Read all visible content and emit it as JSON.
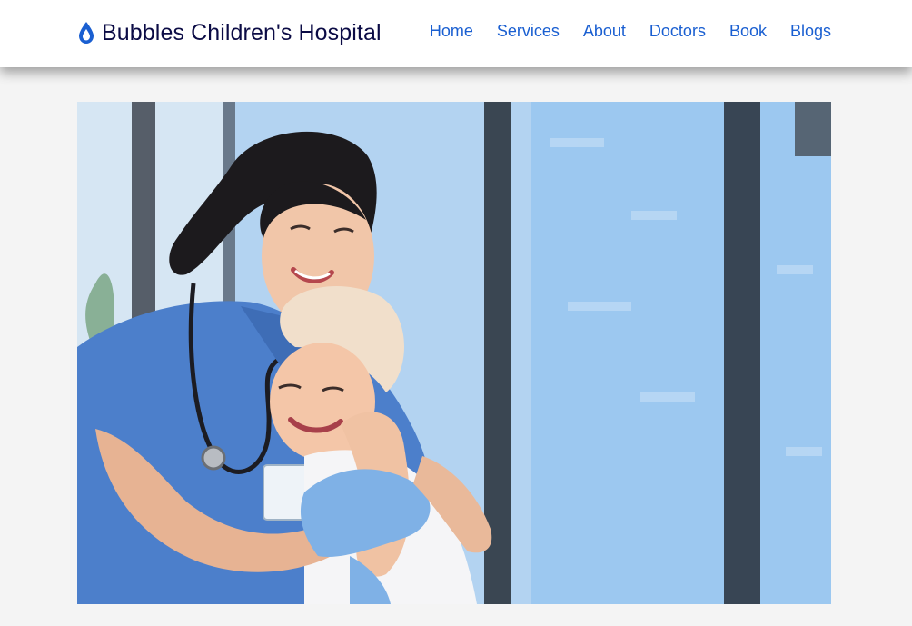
{
  "brand": {
    "icon": "water-drop-icon",
    "name": "Bubbles Children's Hospital",
    "color": "#1a5fd1"
  },
  "nav": {
    "items": [
      {
        "label": "Home"
      },
      {
        "label": "Services"
      },
      {
        "label": "About"
      },
      {
        "label": "Doctors"
      },
      {
        "label": "Book"
      },
      {
        "label": "Blogs"
      }
    ],
    "link_color": "#1a5fd1"
  },
  "hero": {
    "alt": "Smiling nurse in blue scrubs hugging a young child patient wearing a headscarf"
  }
}
